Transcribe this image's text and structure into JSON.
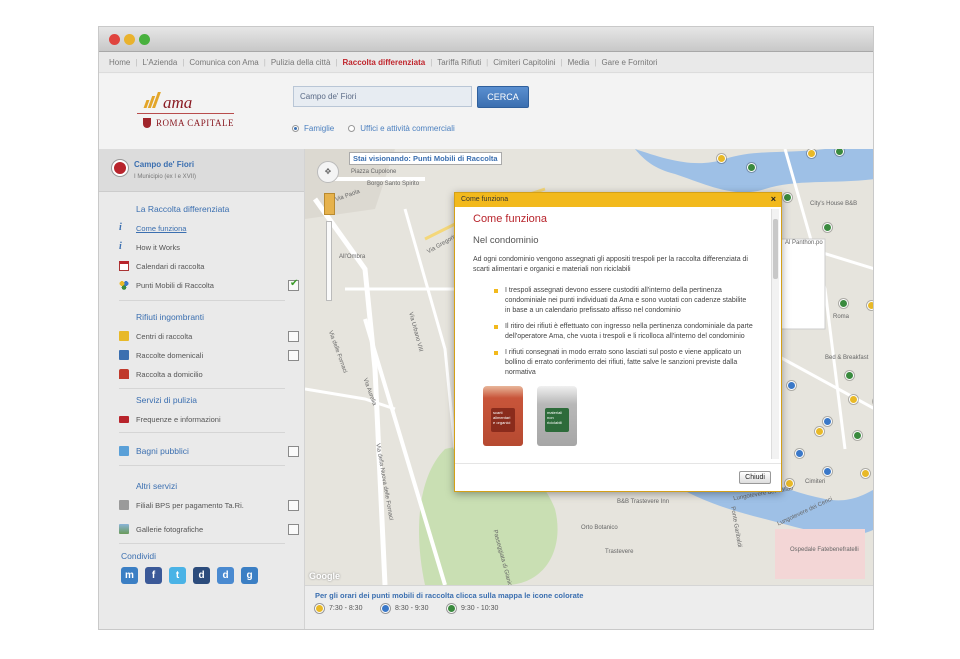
{
  "nav": {
    "items": [
      "Home",
      "L'Azienda",
      "Comunica con Ama",
      "Pulizia della città",
      "Raccolta differenziata",
      "Tariffa Rifiuti",
      "Cimiteri Capitolini",
      "Media",
      "Gare e Fornitori"
    ],
    "active": "Raccolta differenziata"
  },
  "logo": {
    "name": "ama",
    "sub": "ROMA CAPITALE"
  },
  "search": {
    "value": "Campo de' Fiori",
    "button": "CERCA"
  },
  "filters": {
    "option1": "Famiglie",
    "option2": "Uffici e attività commerciali",
    "selected": "Famiglie"
  },
  "location": {
    "name": "Campo de' Fiori",
    "district": "I Municipio (ex I e XVII)"
  },
  "sidebar": {
    "sec1": "La Raccolta differenziata",
    "sec1_items": [
      "Come funziona",
      "How it Works",
      "Calendari di raccolta",
      "Punti Mobili di Raccolta"
    ],
    "sec2": "Rifiuti ingombranti",
    "sec2_items": [
      "Centri di raccolta",
      "Raccolte domenicali",
      "Raccolta a domicilio"
    ],
    "sec3": "Servizi di pulizia",
    "sec3_items": [
      "Frequenze e informazioni"
    ],
    "sec4_items": [
      "Bagni pubblici"
    ],
    "sec5": "Altri servizi",
    "sec5_items": [
      "Filiali BPS per pagamento Ta.Ri.",
      "Gallerie fotografiche"
    ],
    "sec6": "Condividi"
  },
  "map": {
    "banner": "Stai visionando: Punti Mobili di Raccolta",
    "labels": [
      "Borgo Santo Spirito",
      "Via Paola",
      "Via Gregorio VII",
      "Via delle Fornaci",
      "Via della Nuova delle Fornaci",
      "Via Aurelia",
      "Via Urbano VIII",
      "Orto Botanico",
      "Trastevere",
      "Lungotevere dei Vallati",
      "Lungotevere dei Cenci",
      "Ponte Garibaldi",
      "Passeggiata di Gianicolo",
      "All'Ombra",
      "Piazza Cupolone",
      "City's House B&B",
      "Al Panthon.po",
      "Roma",
      "Bed & Breakfast",
      "B&B Trastevere Inn",
      "Cimiteri",
      "Ospedale Fatebenefratelli"
    ],
    "google": "Google"
  },
  "legend": {
    "title": "Per gli orari dei punti mobili di raccolta clicca sulla mappa le icone colorate",
    "items": [
      "7:30 - 8:30",
      "8:30 - 9:30",
      "9:30 - 10:30"
    ],
    "colors": [
      "#e8b928",
      "#3a78c8",
      "#3a8a3e"
    ]
  },
  "modal": {
    "header": "Come funziona",
    "title": "Come funziona",
    "subtitle": "Nel condominio",
    "intro": "Ad ogni condominio vengono assegnati gli appositi trespoli per la raccolta differenziata di scarti alimentari e organici e materiali non riciclabili",
    "bullets": [
      "I trespoli assegnati devono essere custoditi all'interno della pertinenza condominiale nei punti individuati da Ama e sono vuotati con cadenze stabilite in base a un calendario prefissato affisso nel condominio",
      "Il ritiro dei rifiuti è effettuato con ingresso nella pertinenza condominiale da parte dell'operatore Ama, che vuota i trespoli e li ricolloca all'interno del condominio",
      "I rifiuti consegnati in modo errato sono lasciati sul posto e viene applicato un bollino di errato conferimento dei rifiuti, fatte salve le sanzioni previste dalla normativa"
    ],
    "bin1": "scarti alimentari e organici",
    "bin2": "materiali non riciclabili",
    "close": "Chiudi"
  }
}
